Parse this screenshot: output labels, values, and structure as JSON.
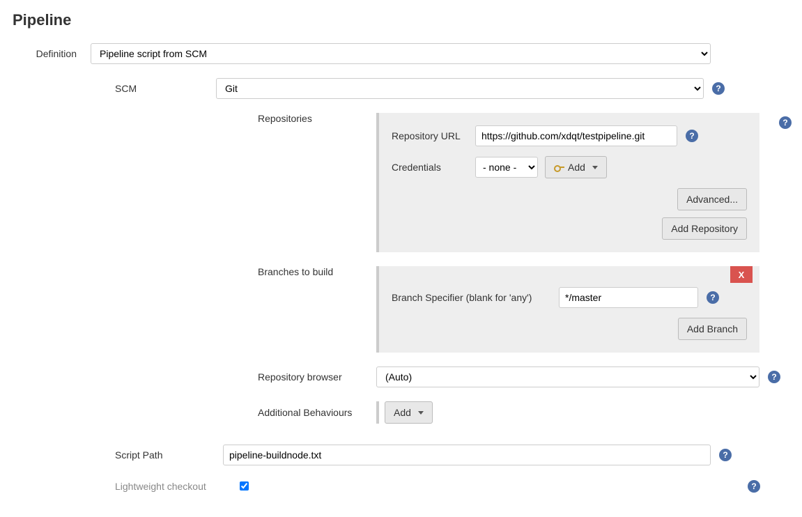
{
  "section_title": "Pipeline",
  "labels": {
    "definition": "Definition",
    "scm": "SCM",
    "repositories": "Repositories",
    "repo_url": "Repository URL",
    "credentials": "Credentials",
    "branches_to_build": "Branches to build",
    "branch_specifier": "Branch Specifier (blank for 'any')",
    "repository_browser": "Repository browser",
    "additional_behaviours": "Additional Behaviours",
    "script_path": "Script Path",
    "lightweight": "Lightweight checkout"
  },
  "values": {
    "definition": "Pipeline script from SCM",
    "scm": "Git",
    "repo_url": "https://github.com/xdqt/testpipeline.git",
    "credentials": "- none -",
    "branch_specifier": "*/master",
    "repository_browser": "(Auto)",
    "script_path": "pipeline-buildnode.txt",
    "lightweight_checked": true
  },
  "buttons": {
    "add": "Add",
    "advanced": "Advanced...",
    "add_repository": "Add Repository",
    "delete": "X",
    "add_branch": "Add Branch"
  },
  "help": "?"
}
